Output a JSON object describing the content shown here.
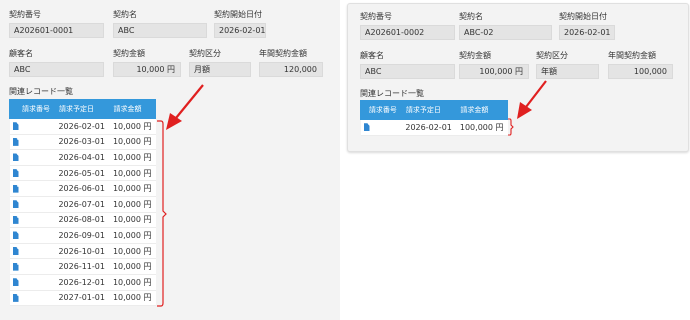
{
  "left": {
    "contract_no_label": "契約番号",
    "contract_no": "A202601-0001",
    "contract_name_label": "契約名",
    "contract_name": "ABC",
    "start_date_label": "契約開始日付",
    "start_date": "2026-02-01",
    "customer_label": "顧客名",
    "customer": "ABC",
    "amount_label": "契約金額",
    "amount": "10,000 円",
    "category_label": "契約区分",
    "category": "月額",
    "annual_label": "年間契約金額",
    "annual": "120,000",
    "related_label": "関連レコード一覧",
    "headers": [
      "請求番号",
      "請求予定日",
      "請求金額"
    ],
    "rows": [
      {
        "date": "2026-02-01",
        "amount": "10,000 円"
      },
      {
        "date": "2026-03-01",
        "amount": "10,000 円"
      },
      {
        "date": "2026-04-01",
        "amount": "10,000 円"
      },
      {
        "date": "2026-05-01",
        "amount": "10,000 円"
      },
      {
        "date": "2026-06-01",
        "amount": "10,000 円"
      },
      {
        "date": "2026-07-01",
        "amount": "10,000 円"
      },
      {
        "date": "2026-08-01",
        "amount": "10,000 円"
      },
      {
        "date": "2026-09-01",
        "amount": "10,000 円"
      },
      {
        "date": "2026-10-01",
        "amount": "10,000 円"
      },
      {
        "date": "2026-11-01",
        "amount": "10,000 円"
      },
      {
        "date": "2026-12-01",
        "amount": "10,000 円"
      },
      {
        "date": "2027-01-01",
        "amount": "10,000 円"
      }
    ]
  },
  "right": {
    "contract_no_label": "契約番号",
    "contract_no": "A202601-0002",
    "contract_name_label": "契約名",
    "contract_name": "ABC-02",
    "start_date_label": "契約開始日付",
    "start_date": "2026-02-01",
    "customer_label": "顧客名",
    "customer": "ABC",
    "amount_label": "契約金額",
    "amount": "100,000 円",
    "category_label": "契約区分",
    "category": "年額",
    "annual_label": "年間契約金額",
    "annual": "100,000",
    "related_label": "関連レコード一覧",
    "headers": [
      "請求番号",
      "請求予定日",
      "請求金額"
    ],
    "rows": [
      {
        "date": "2026-02-01",
        "amount": "100,000 円"
      }
    ]
  },
  "colors": {
    "header_blue": "#3498db",
    "annotation_red": "#e02020",
    "doc_icon": "#2f86d1"
  },
  "icons": {
    "record_icon": "document-icon",
    "annotation": "red-arrow"
  }
}
